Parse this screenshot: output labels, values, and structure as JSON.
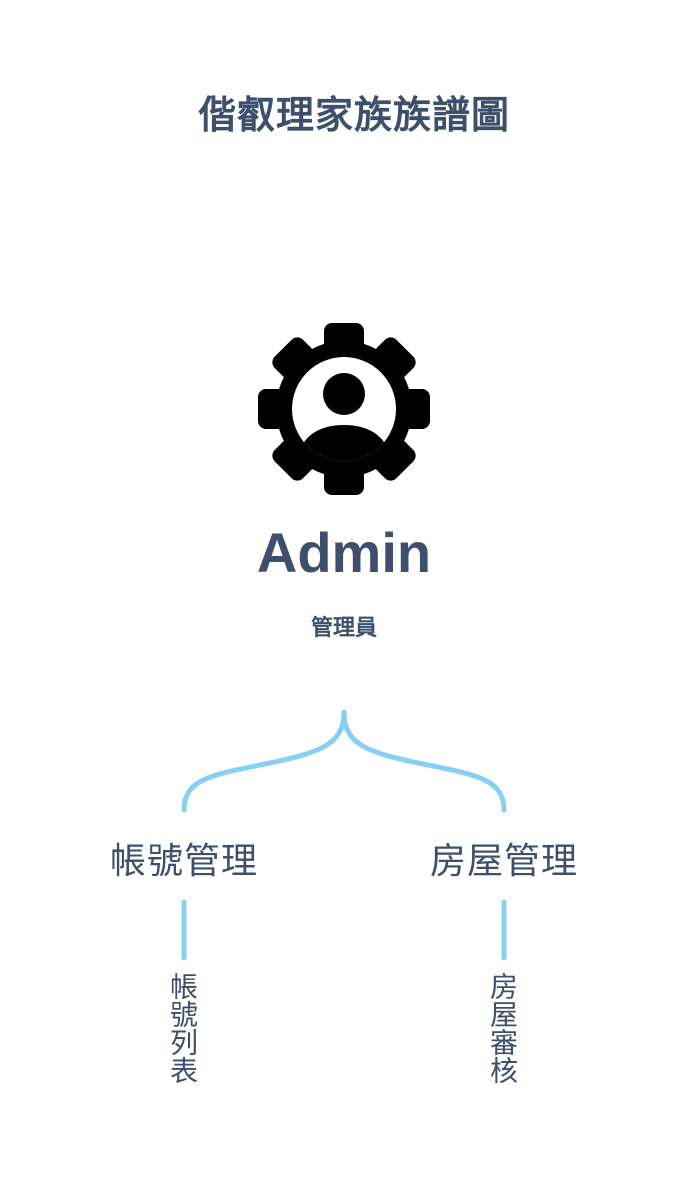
{
  "title": "偕叡理家族族譜圖",
  "root": {
    "name": "Admin",
    "subtitle": "管理員",
    "icon": "user-gear-icon"
  },
  "branches": [
    {
      "label": "帳號管理",
      "leaf": "帳號列表"
    },
    {
      "label": "房屋管理",
      "leaf": "房屋審核"
    }
  ],
  "colors": {
    "text": "#3d4f6b",
    "connector": "#87cff3",
    "icon": "#000000"
  }
}
